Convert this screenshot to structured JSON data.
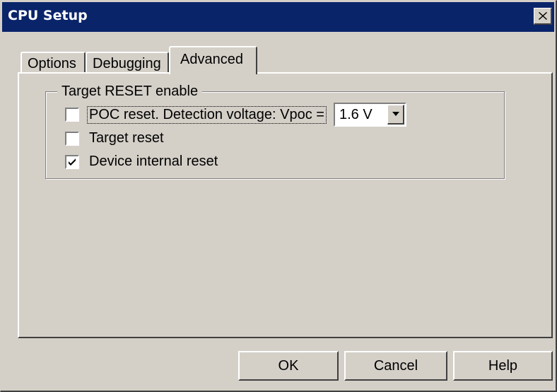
{
  "window": {
    "title": "CPU Setup"
  },
  "tabs": [
    {
      "label": "Options"
    },
    {
      "label": "Debugging"
    },
    {
      "label": "Advanced",
      "selected": true
    }
  ],
  "group": {
    "legend": "Target RESET enable",
    "options": [
      {
        "label": "POC reset. Detection voltage: Vpoc =",
        "checked": false,
        "focused": true
      },
      {
        "label": "Target reset",
        "checked": false
      },
      {
        "label": "Device internal reset",
        "checked": true
      }
    ],
    "vpoc_select": {
      "value": "1.6 V"
    }
  },
  "buttons": {
    "ok": "OK",
    "cancel": "Cancel",
    "help": "Help"
  },
  "colors": {
    "titlebar": "#0a246a",
    "face": "#d4d0c8"
  },
  "icons": {
    "close": "close-icon",
    "dropdown": "chevron-down-icon",
    "check": "checkmark-icon"
  }
}
